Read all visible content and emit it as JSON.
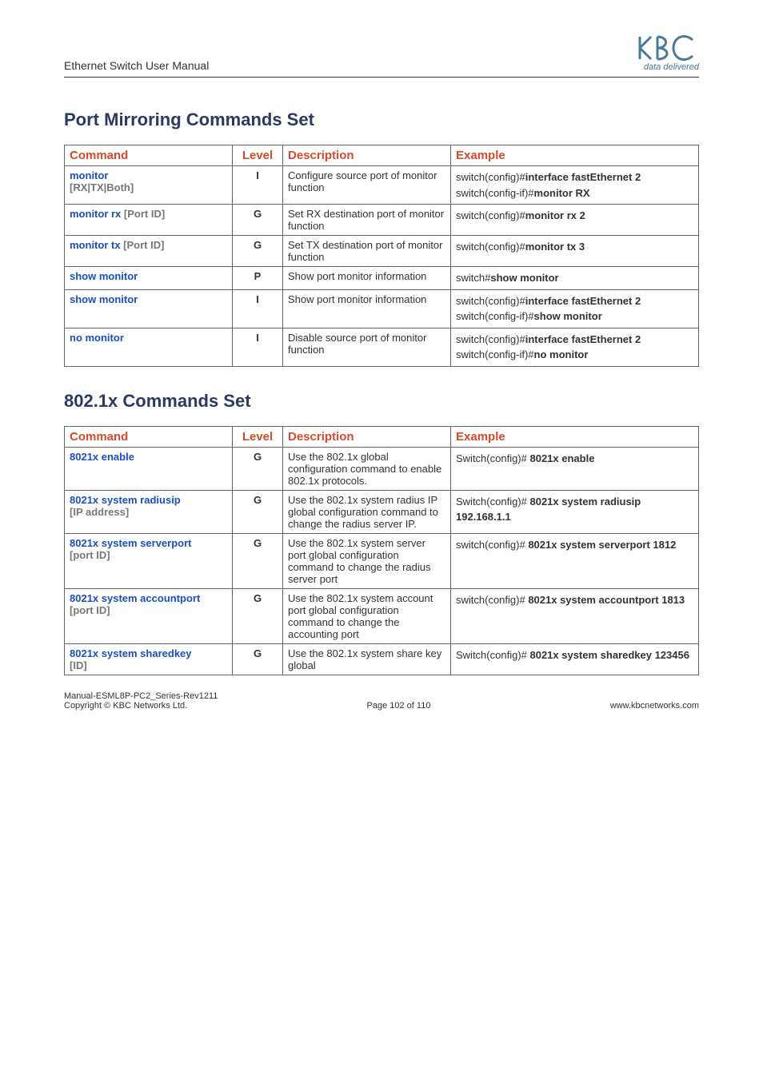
{
  "header": {
    "title": "Ethernet Switch User Manual",
    "logo_tag": "data delivered"
  },
  "sections": [
    {
      "title": "Port Mirroring Commands Set",
      "headers": {
        "c1": "Command",
        "c2": "Level",
        "c3": "Description",
        "c4": "Example"
      },
      "rows": [
        {
          "cmd_name": "monitor",
          "cmd_arg": "[RX|TX|Both]",
          "level": "I",
          "desc": "Configure source port of monitor function",
          "example": [
            {
              "pre": "switch(config)#",
              "bold": "interface fastEthernet 2"
            },
            {
              "pre": "switch(config-if)#",
              "bold": "monitor RX"
            }
          ]
        },
        {
          "cmd_name": "monitor rx",
          "cmd_arg": " [Port ID]",
          "level": "G",
          "desc": "Set RX destination port of monitor function",
          "example": [
            {
              "pre": "switch(config)#",
              "bold": "monitor rx 2"
            }
          ]
        },
        {
          "cmd_name": "monitor tx",
          "cmd_arg": " [Port ID]",
          "level": "G",
          "desc": "Set TX destination port of monitor function",
          "example": [
            {
              "pre": "switch(config)#",
              "bold": "monitor tx 3"
            }
          ]
        },
        {
          "cmd_name": "show monitor",
          "cmd_arg": "",
          "level": "P",
          "desc": "Show port monitor information",
          "example": [
            {
              "pre": "switch#",
              "bold": "show monitor"
            }
          ]
        },
        {
          "cmd_name": "show monitor",
          "cmd_arg": "",
          "level": "I",
          "desc": "Show port monitor information",
          "example": [
            {
              "pre": "switch(config)#",
              "bold": "interface fastEthernet 2"
            },
            {
              "pre": "switch(config-if)#",
              "bold": "show monitor"
            }
          ]
        },
        {
          "cmd_name": "no monitor",
          "cmd_arg": "",
          "level": "I",
          "desc": "Disable source port of monitor function",
          "example": [
            {
              "pre": "switch(config)#",
              "bold": "interface fastEthernet 2"
            },
            {
              "pre": "switch(config-if)#",
              "bold": "no monitor"
            }
          ]
        }
      ]
    },
    {
      "title": "802.1x Commands Set",
      "headers": {
        "c1": "Command",
        "c2": "Level",
        "c3": "Description",
        "c4": "Example"
      },
      "rows": [
        {
          "cmd_name": "8021x enable",
          "cmd_arg": "",
          "level": "G",
          "desc": "Use the 802.1x global configuration command to enable 802.1x protocols.",
          "example": [
            {
              "pre": "Switch(config)# ",
              "bold": "8021x enable"
            }
          ]
        },
        {
          "cmd_name": "8021x system radiusip",
          "cmd_arg": "[IP address]",
          "level": "G",
          "desc": "Use the 802.1x system radius IP global configuration command to change the radius server IP.",
          "example": [
            {
              "pre": "Switch(config)# ",
              "bold": "8021x system radiusip 192.168.1.1"
            }
          ]
        },
        {
          "cmd_name": "8021x system serverport",
          "cmd_arg": "[port ID]",
          "level": "G",
          "desc": "Use the 802.1x system server port global configuration command to change the radius server port",
          "example": [
            {
              "pre": "switch(config)# ",
              "bold": "8021x system serverport 1812"
            }
          ]
        },
        {
          "cmd_name": "8021x system accountport",
          "cmd_arg": "[port ID]",
          "level": "G",
          "desc": "Use the 802.1x system account port global configuration command to change the accounting port",
          "example": [
            {
              "pre": "switch(config)# ",
              "bold": "8021x system accountport 1813"
            }
          ]
        },
        {
          "cmd_name": "8021x system sharedkey",
          "cmd_arg": "[ID]",
          "level": "G",
          "desc": "Use the 802.1x system share key global",
          "example": [
            {
              "pre": "Switch(config)# ",
              "bold": "8021x system sharedkey 123456"
            }
          ]
        }
      ]
    }
  ],
  "footer": {
    "line1": "Manual-ESML8P-PC2_Series-Rev1211",
    "copyright": "Copyright © KBC Networks Ltd.",
    "page": "Page 102 of 110",
    "url": "www.kbcnetworks.com"
  }
}
